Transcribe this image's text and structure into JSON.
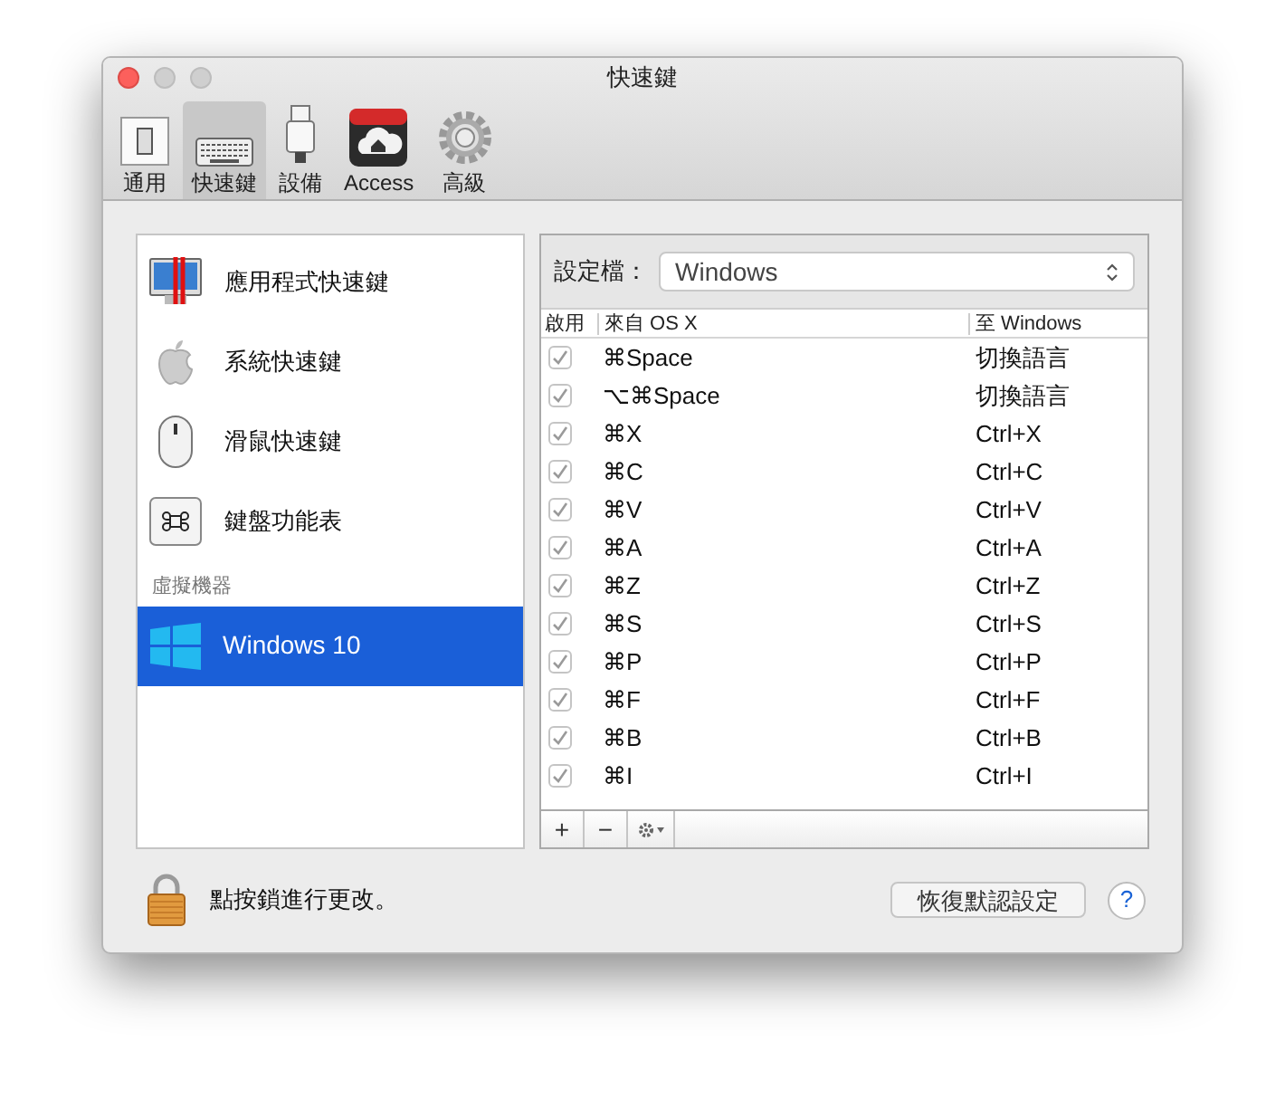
{
  "window": {
    "title": "快速鍵"
  },
  "toolbar": {
    "tabs": [
      {
        "label": "通用",
        "kind": "switch",
        "selected": false
      },
      {
        "label": "快速鍵",
        "kind": "keyboard",
        "selected": true
      },
      {
        "label": "設備",
        "kind": "usb",
        "selected": false
      },
      {
        "label": "Access",
        "kind": "cloud",
        "selected": false
      },
      {
        "label": "高級",
        "kind": "gear",
        "selected": false
      }
    ]
  },
  "sidebar": {
    "items": [
      {
        "label": "應用程式快速鍵",
        "kind": "app",
        "selected": false
      },
      {
        "label": "系統快速鍵",
        "kind": "apple",
        "selected": false
      },
      {
        "label": "滑鼠快速鍵",
        "kind": "mouse",
        "selected": false
      },
      {
        "label": "鍵盤功能表",
        "kind": "command",
        "selected": false
      }
    ],
    "section": "虛擬機器",
    "vms": [
      {
        "label": "Windows 10",
        "selected": true
      }
    ]
  },
  "profile": {
    "label": "設定檔：",
    "value": "Windows"
  },
  "table": {
    "columns": [
      "啟用",
      "來自 OS X",
      "至 Windows"
    ],
    "rows": [
      {
        "checked": true,
        "from": "⌘Space",
        "to": "切換語言"
      },
      {
        "checked": true,
        "from": "⌥⌘Space",
        "to": "切換語言"
      },
      {
        "checked": true,
        "from": "⌘X",
        "to": "Ctrl+X"
      },
      {
        "checked": true,
        "from": "⌘C",
        "to": "Ctrl+C"
      },
      {
        "checked": true,
        "from": "⌘V",
        "to": "Ctrl+V"
      },
      {
        "checked": true,
        "from": "⌘A",
        "to": "Ctrl+A"
      },
      {
        "checked": true,
        "from": "⌘Z",
        "to": "Ctrl+Z"
      },
      {
        "checked": true,
        "from": "⌘S",
        "to": "Ctrl+S"
      },
      {
        "checked": true,
        "from": "⌘P",
        "to": "Ctrl+P"
      },
      {
        "checked": true,
        "from": "⌘F",
        "to": "Ctrl+F"
      },
      {
        "checked": true,
        "from": "⌘B",
        "to": "Ctrl+B"
      },
      {
        "checked": true,
        "from": "⌘I",
        "to": "Ctrl+I"
      }
    ],
    "buttons": [
      "+",
      "−"
    ]
  },
  "footer": {
    "lock_text": "點按鎖進行更改。",
    "restore_button": "恢復默認設定",
    "help_button": "?"
  }
}
